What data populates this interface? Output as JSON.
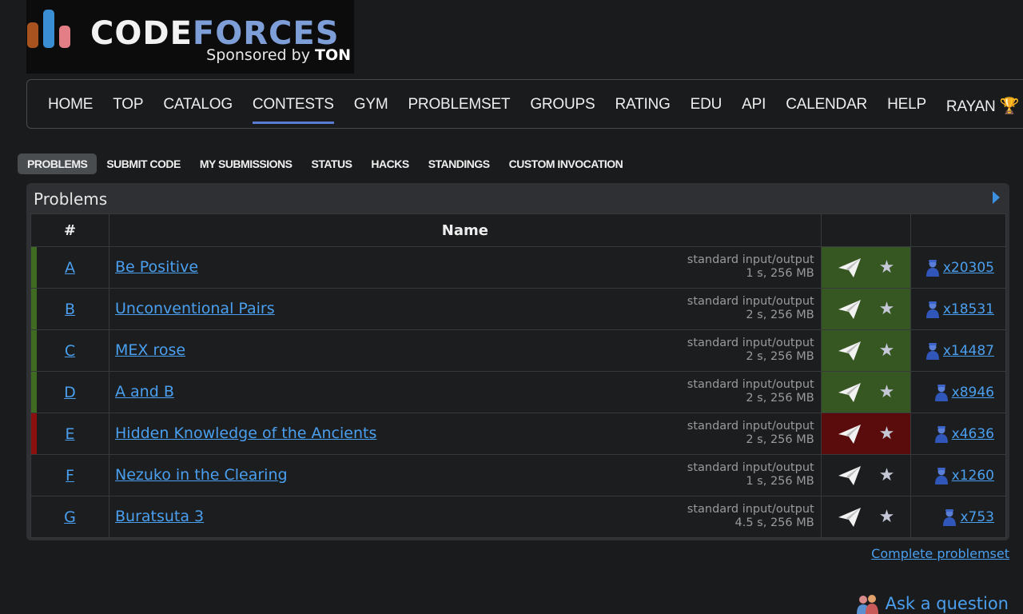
{
  "logo": {
    "code": "CODE",
    "forces": "FORCES",
    "sponsor_prefix": "Sponsored by ",
    "sponsor_brand": "TON"
  },
  "menu": {
    "items": [
      "HOME",
      "TOP",
      "CATALOG",
      "CONTESTS",
      "GYM",
      "PROBLEMSET",
      "GROUPS",
      "RATING",
      "EDU",
      "API",
      "CALENDAR",
      "HELP",
      "RAYAN"
    ],
    "active": "CONTESTS"
  },
  "submenu": [
    "PROBLEMS",
    "SUBMIT CODE",
    "MY SUBMISSIONS",
    "STATUS",
    "HACKS",
    "STANDINGS",
    "CUSTOM INVOCATION"
  ],
  "panel": {
    "title": "Problems"
  },
  "table": {
    "headers": {
      "index": "#",
      "name": "Name"
    },
    "rows": [
      {
        "index": "A",
        "name": "Be Positive",
        "io": "standard input/output",
        "limits": "1 s, 256 MB",
        "solved": "x20305",
        "status": "accepted"
      },
      {
        "index": "B",
        "name": "Unconventional Pairs",
        "io": "standard input/output",
        "limits": "2 s, 256 MB",
        "solved": "x18531",
        "status": "accepted"
      },
      {
        "index": "C",
        "name": "MEX rose",
        "io": "standard input/output",
        "limits": "2 s, 256 MB",
        "solved": "x14487",
        "status": "accepted"
      },
      {
        "index": "D",
        "name": "A and B",
        "io": "standard input/output",
        "limits": "2 s, 256 MB",
        "solved": "x8946",
        "status": "accepted"
      },
      {
        "index": "E",
        "name": "Hidden Knowledge of the Ancients",
        "io": "standard input/output",
        "limits": "2 s, 256 MB",
        "solved": "x4636",
        "status": "rejected"
      },
      {
        "index": "F",
        "name": "Nezuko in the Clearing",
        "io": "standard input/output",
        "limits": "1 s, 256 MB",
        "solved": "x1260",
        "status": "none"
      },
      {
        "index": "G",
        "name": "Buratsuta 3",
        "io": "standard input/output",
        "limits": "4.5 s, 256 MB",
        "solved": "x753",
        "status": "none"
      }
    ]
  },
  "links": {
    "complete_problemset": "Complete problemset",
    "ask_question": "Ask a question"
  },
  "colors": {
    "accepted": "#365622",
    "accepted_marker": "#3e6a22",
    "rejected": "#5a0c0c",
    "rejected_marker": "#8b0f0f",
    "link": "#4a9fef"
  }
}
